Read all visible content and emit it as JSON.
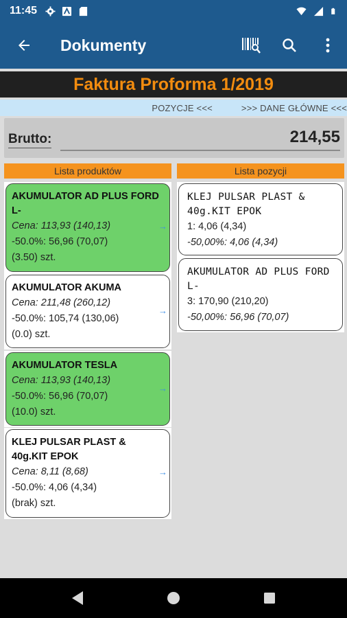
{
  "status_bar": {
    "time": "11:45",
    "icons": [
      "gear-icon",
      "nfc-icon",
      "sd-card-icon"
    ],
    "right_icons": [
      "wifi-icon",
      "signal-icon",
      "battery-icon"
    ]
  },
  "app_bar": {
    "title": "Dokumenty",
    "actions": [
      "barcode-search-icon",
      "search-icon",
      "more-vert-icon"
    ]
  },
  "document": {
    "title": "Faktura Proforma 1/2019"
  },
  "nav_strip": {
    "pozycje": "POZYCJE <<<",
    "dane": ">>> DANE GŁÓWNE <<<"
  },
  "summary": {
    "brutto_label": "Brutto:",
    "brutto_value": "214,55"
  },
  "products": {
    "header": "Lista produktów",
    "items": [
      {
        "name": "AKUMULATOR AD PLUS FORD L-",
        "price": "Cena: 113,93 (140,13)",
        "discount": "-50.0%: 56,96 (70,07)",
        "qty": "(3.50) szt.",
        "highlight": true
      },
      {
        "name": "AKUMULATOR AKUMA",
        "price": "Cena: 211,48 (260,12)",
        "discount": "-50.0%: 105,74 (130,06)",
        "qty": "(0.0) szt.",
        "highlight": false
      },
      {
        "name": "AKUMULATOR TESLA",
        "price": "Cena: 113,93 (140,13)",
        "discount": "-50.0%: 56,96 (70,07)",
        "qty": "(10.0) szt.",
        "highlight": true
      },
      {
        "name": "KLEJ PULSAR PLAST & 40g.KIT EPOK",
        "price": "Cena: 8,11 (8,68)",
        "discount": "-50.0%: 4,06 (4,34)",
        "qty": "(brak) szt.",
        "highlight": false
      }
    ]
  },
  "positions": {
    "header": "Lista pozycji",
    "items": [
      {
        "name": "KLEJ PULSAR PLAST & 40g.KIT EPOK",
        "line": "1: 4,06 (4,34)",
        "discount": "-50,00%: 4,06 (4,34)"
      },
      {
        "name": "AKUMULATOR AD PLUS FORD L-",
        "line": "3: 170,90 (210,20)",
        "discount": "-50,00%: 56,96 (70,07)"
      }
    ]
  },
  "system_nav": [
    "back-icon",
    "home-icon",
    "recents-icon"
  ],
  "colors": {
    "primary": "#1e5a8e",
    "accent": "#f28c0f",
    "header_orange": "#f5931e",
    "highlight_green": "#6ed16a",
    "nav_strip": "#c8e5f8"
  }
}
